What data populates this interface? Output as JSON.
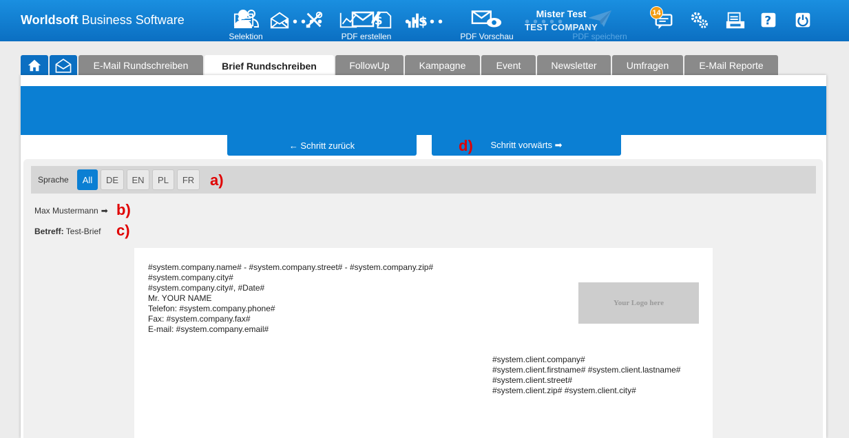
{
  "header": {
    "brand_bold": "Worldsoft",
    "brand_rest": " Business Software",
    "user_name": "Mister Test",
    "company": "TEST COMPANY",
    "notification_count": "14",
    "icons": [
      "contact-card-icon",
      "mail-icon",
      "tools-icon",
      "chart-icon",
      "invoice-icon",
      "revenue-icon",
      "messages-icon",
      "settings-icon",
      "print-icon",
      "help-icon",
      "power-icon"
    ]
  },
  "tabs": [
    {
      "label": "E-Mail Rundschreiben"
    },
    {
      "label": "Brief Rundschreiben"
    },
    {
      "label": "FollowUp"
    },
    {
      "label": "Kampagne"
    },
    {
      "label": "Event"
    },
    {
      "label": "Newsletter"
    },
    {
      "label": "Umfragen"
    },
    {
      "label": "E-Mail Reporte"
    }
  ],
  "wizard": {
    "steps": [
      {
        "label": "Selektion"
      },
      {
        "label": "PDF erstellen"
      },
      {
        "label": "PDF Vorschau"
      },
      {
        "label": "PDF speichern"
      }
    ],
    "dots": "•••••",
    "back": "← Schritt zurück",
    "forward": "Schritt vorwärts ➡"
  },
  "language": {
    "label": "Sprache",
    "options": [
      "All",
      "DE",
      "EN",
      "PL",
      "FR"
    ],
    "selected": "All"
  },
  "markers": {
    "a": "a)",
    "b": "b)",
    "c": "c)",
    "d": "d)"
  },
  "recipient": {
    "name": "Max Mustermann",
    "arrow": "➡"
  },
  "subject": {
    "label": "Betreff:",
    "value": " Test-Brief"
  },
  "letter": {
    "sender_lines": [
      "#system.company.name# - #system.company.street# - #system.company.zip#",
      "#system.company.city#",
      "#system.company.city#, #Date#",
      "Mr. YOUR NAME",
      "Telefon: #system.company.phone#",
      "Fax: #system.company.fax#",
      "E-mail: #system.company.email#"
    ],
    "logo_text": "Your Logo here",
    "client_lines": [
      "#system.client.company#",
      "#system.client.firstname# #system.client.lastname#",
      "#system.client.street#",
      "#system.client.zip# #system.client.city#"
    ]
  },
  "colors": {
    "primary": "#0b7fd3",
    "header": "#1a8fe0",
    "marker": "#e00000",
    "badge": "#f39c12"
  }
}
